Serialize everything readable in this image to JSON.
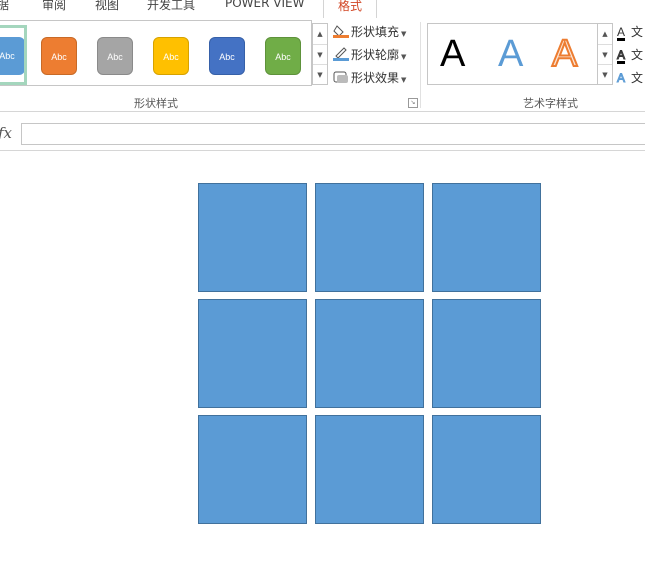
{
  "tabs": [
    "据",
    "审阅",
    "视图",
    "开发工具",
    "POWER VIEW",
    "格式"
  ],
  "ribbon": {
    "shape_styles": {
      "items": [
        {
          "label": "Abc",
          "color": "#5b9bd5"
        },
        {
          "label": "Abc",
          "color": "#ed7d31"
        },
        {
          "label": "Abc",
          "color": "#a5a5a5"
        },
        {
          "label": "Abc",
          "color": "#ffc000"
        },
        {
          "label": "Abc",
          "color": "#4472c4"
        },
        {
          "label": "Abc",
          "color": "#70ad47"
        }
      ],
      "fill": "形状填充",
      "outline": "形状轮廓",
      "effects": "形状效果",
      "group_label": "形状样式"
    },
    "wordart": {
      "samples": [
        "A",
        "A",
        "A"
      ],
      "text_cmds": [
        "文",
        "文",
        "文"
      ],
      "group_label": "艺术字样式"
    }
  },
  "formula_bar": {
    "fx": "fx",
    "value": ""
  },
  "canvas": {
    "shape_color": "#5b9bd5",
    "rows": 3,
    "cols": 3
  }
}
